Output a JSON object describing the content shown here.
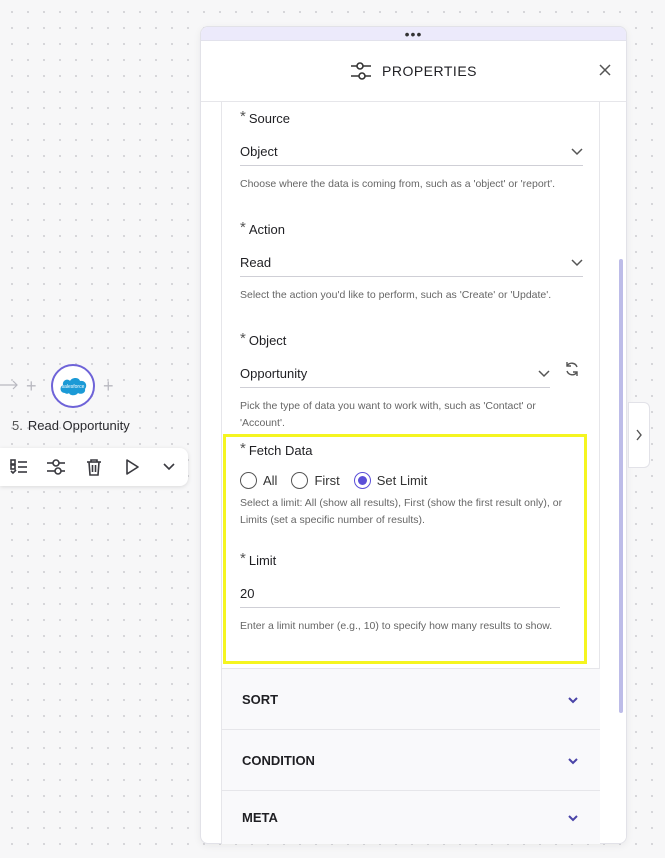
{
  "canvas": {
    "node": {
      "step_number": "5.",
      "label": "Read Opportunity",
      "logo_text": "salesforce",
      "icon": "salesforce-cloud-icon"
    },
    "toolbar": {
      "icons": [
        "checklist-icon",
        "settings-sliders-icon",
        "trash-icon",
        "play-icon",
        "chevron-down-icon"
      ]
    }
  },
  "panel": {
    "drag_handle": "•••",
    "title": "PROPERTIES",
    "title_icon": "sliders-icon",
    "fields": {
      "source": {
        "label": "Source",
        "value": "Object",
        "help": "Choose where the data is coming from, such as a 'object' or 'report'."
      },
      "action": {
        "label": "Action",
        "value": "Read",
        "help": "Select the action you'd like to perform, such as 'Create' or 'Update'."
      },
      "object": {
        "label": "Object",
        "value": "Opportunity",
        "help": "Pick the type of data you want to work with, such as 'Contact' or 'Account'."
      },
      "fetch_data": {
        "label": "Fetch Data",
        "options": [
          "All",
          "First",
          "Set Limit"
        ],
        "selected": "Set Limit",
        "help": "Select a limit: All (show all results), First (show the first result only), or Limits (set a specific number of results)."
      },
      "limit": {
        "label": "Limit",
        "value": "20",
        "help": "Enter a limit number (e.g., 10) to specify how many results to show."
      }
    },
    "sections": [
      "SORT",
      "CONDITION",
      "META"
    ],
    "required_marker": "*",
    "highlight_color": "#f5f520",
    "accent_color": "#5b4fd8"
  }
}
